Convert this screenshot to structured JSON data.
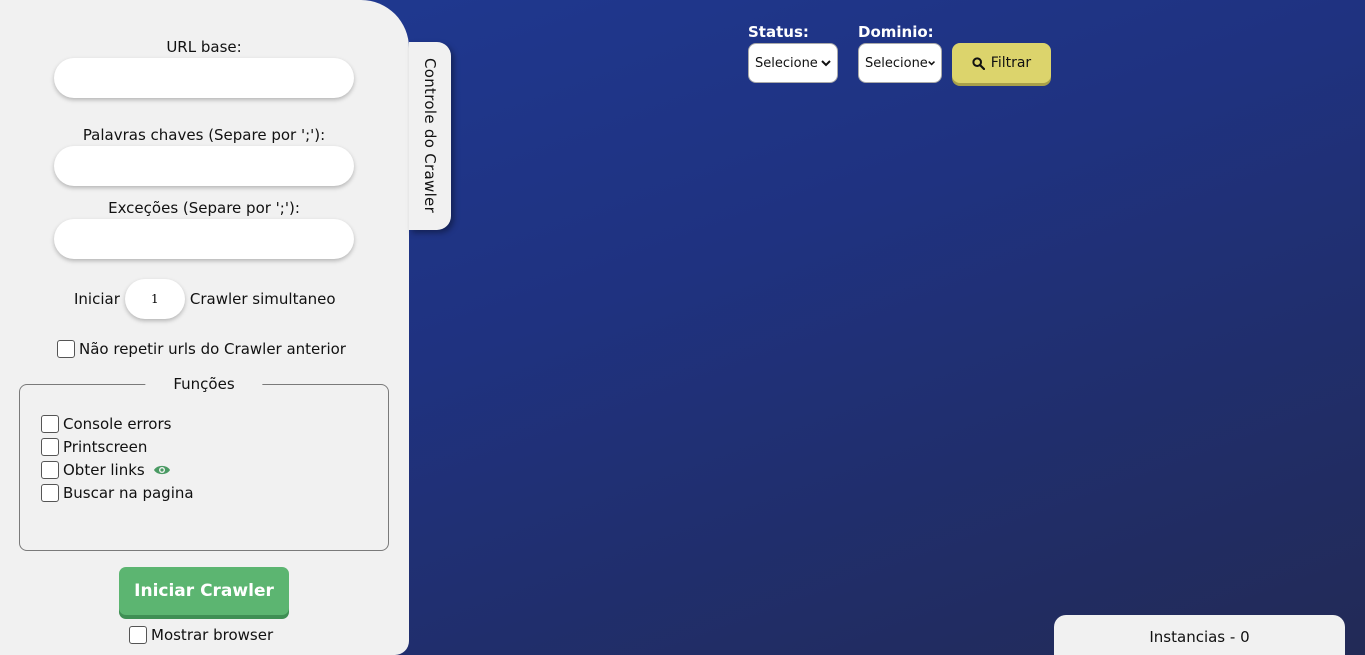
{
  "sidebar": {
    "tab_label": "Controle do Crawler",
    "url_label": "URL base:",
    "url_value": "",
    "keywords_label": "Palavras chaves (Separe por ';'):",
    "keywords_value": "",
    "exceptions_label": "Exceções (Separe por ';'):",
    "exceptions_value": "",
    "start_prefix": "Iniciar",
    "simultaneous_count": "1",
    "start_suffix": "Crawler simultaneo",
    "no_repeat_label": "Não repetir urls do Crawler anterior",
    "functions_legend": "Funções",
    "functions": [
      {
        "label": "Console errors",
        "checked": false
      },
      {
        "label": "Printscreen",
        "checked": false
      },
      {
        "label": "Obter links",
        "checked": false
      },
      {
        "label": "Buscar na pagina",
        "checked": false
      }
    ],
    "start_button": "Iniciar Crawler",
    "show_browser_label": "Mostrar browser"
  },
  "filters": {
    "status_label": "Status:",
    "status_selected": "Selecione",
    "domain_label": "Dominio:",
    "domain_selected": "Selecione",
    "filter_button": "Filtrar"
  },
  "instances": {
    "label": "Instancias - 0"
  },
  "icons": {
    "links_preview": "eye-icon",
    "filter": "search-icon",
    "dropdown": "chevron-down-icon"
  },
  "colors": {
    "background_top": "#1f3a94",
    "background_bottom": "#222a56",
    "panel": "#f1f1f1",
    "start_button": "#5cb571",
    "filter_button": "#dcd46c",
    "eye_icon": "#4a9a63"
  }
}
